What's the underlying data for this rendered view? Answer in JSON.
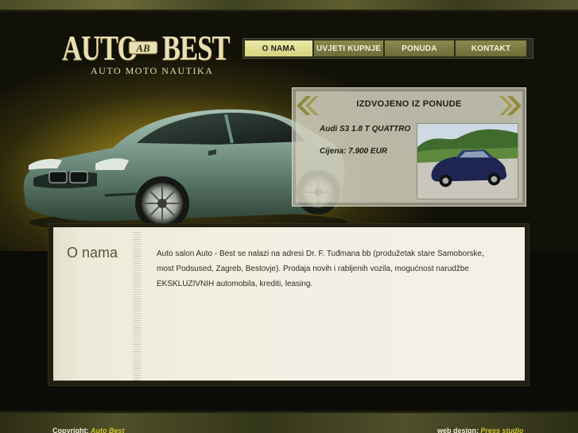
{
  "logo": {
    "word1": "AUTO",
    "word2": "BEST",
    "emblem": "AB",
    "subtitle": "AUTO MOTO NAUTIKA"
  },
  "nav": {
    "items": [
      {
        "label": "O NAMA",
        "active": true
      },
      {
        "label": "UVJETI KUPNJE",
        "active": false
      },
      {
        "label": "PONUDA",
        "active": false
      },
      {
        "label": "KONTAKT",
        "active": false
      }
    ]
  },
  "featured": {
    "title": "IZDVOJENO IZ PONUDE",
    "car_name": "Audi S3 1.8 T QUATTRO",
    "price": "Cijena: 7.900 EUR",
    "prev_icon": "double-chevron-left-icon",
    "next_icon": "double-chevron-right-icon"
  },
  "content": {
    "title": "O nama",
    "text": "Auto salon Auto - Best se nalazi na adresi Dr. F. Tuđmana bb (produžetak stare Samoborske, most Podsused, Zagreb, Bestovje). Prodaja novih i rabljenih vozila, mogućnost narudžbe EKSKLUZIVNIH automobila, krediti, leasing."
  },
  "footer": {
    "copyright_label": "Copyright:",
    "copyright_name": "Auto Best",
    "design_label": "web design:",
    "design_name": "Press studio"
  },
  "colors": {
    "accent": "#c9c22c",
    "nav_active": "#e3e08f",
    "nav_inactive": "#7c7a44",
    "background": "#0b0b08"
  }
}
